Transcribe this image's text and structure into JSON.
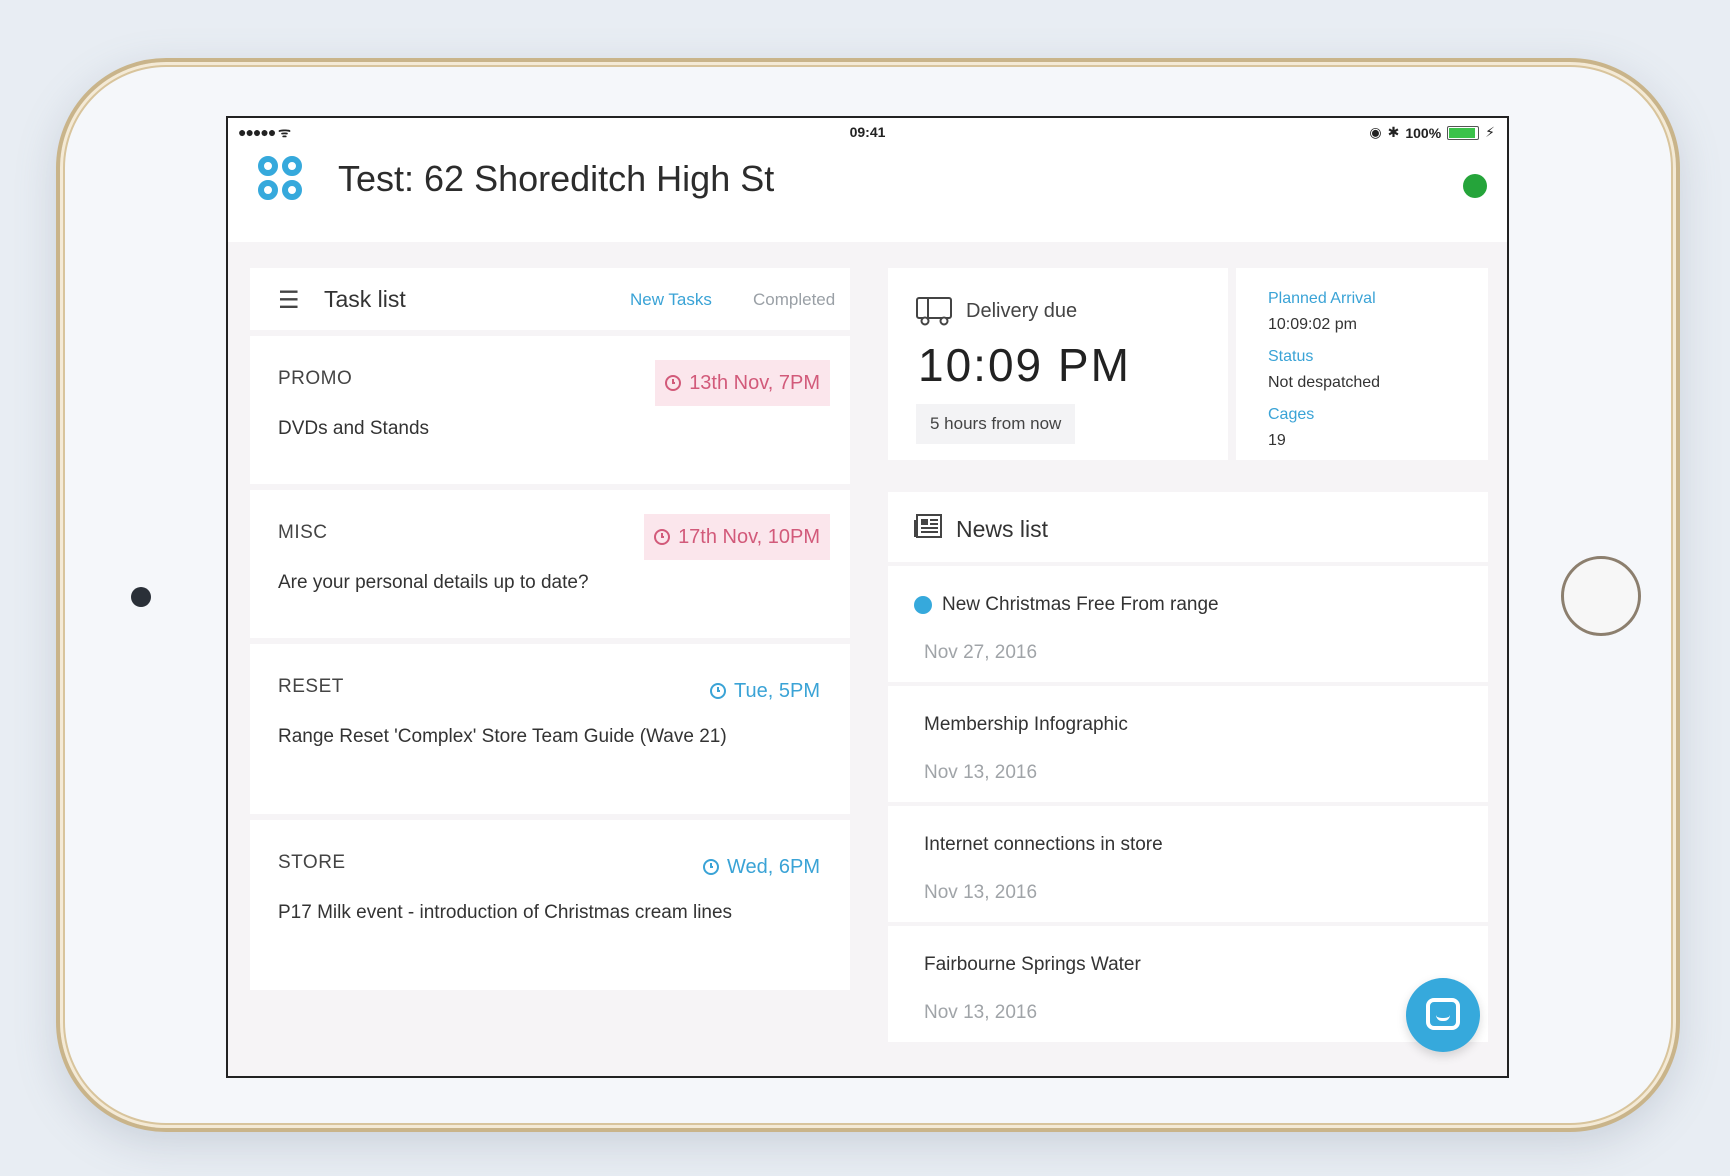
{
  "status_bar": {
    "signal": "●●●●● ᯤ",
    "time": "09:41",
    "battery_percent": "100%"
  },
  "header": {
    "title": "Test: 62 Shoreditch High St",
    "online_status_color": "#25a43a"
  },
  "tasks": {
    "title": "Task list",
    "tabs": [
      "New Tasks",
      "Completed"
    ],
    "items": [
      {
        "category": "PROMO",
        "description": "DVDs and Stands",
        "due": "13th Nov, 7PM",
        "urgent": true
      },
      {
        "category": "MISC",
        "description": "Are your personal details up to date?",
        "due": "17th Nov, 10PM",
        "urgent": true
      },
      {
        "category": "RESET",
        "description": "Range Reset 'Complex' Store Team Guide (Wave 21)",
        "due": "Tue, 5PM",
        "urgent": false
      },
      {
        "category": "STORE",
        "description": "P17 Milk event - introduction of Christmas cream lines",
        "due": "Wed, 6PM",
        "urgent": false
      }
    ]
  },
  "delivery": {
    "label": "Delivery due",
    "time": "10:09 PM",
    "relative": "5 hours from now",
    "planned_arrival_label": "Planned Arrival",
    "planned_arrival_value": "10:09:02 pm",
    "status_label": "Status",
    "status_value": "Not despatched",
    "cages_label": "Cages",
    "cages_value": "19"
  },
  "news": {
    "title": "News list",
    "items": [
      {
        "headline": "New Christmas Free From range",
        "date": "Nov 27, 2016",
        "unread": true
      },
      {
        "headline": "Membership Infographic",
        "date": "Nov 13, 2016",
        "unread": false
      },
      {
        "headline": "Internet connections in store",
        "date": "Nov 13, 2016",
        "unread": false
      },
      {
        "headline": "Fairbourne Springs Water",
        "date": "Nov 13, 2016",
        "unread": false
      }
    ]
  },
  "colors": {
    "accent": "#36a9dc",
    "urgent_text": "#d25a7a",
    "urgent_bg": "#fbe6ec"
  }
}
